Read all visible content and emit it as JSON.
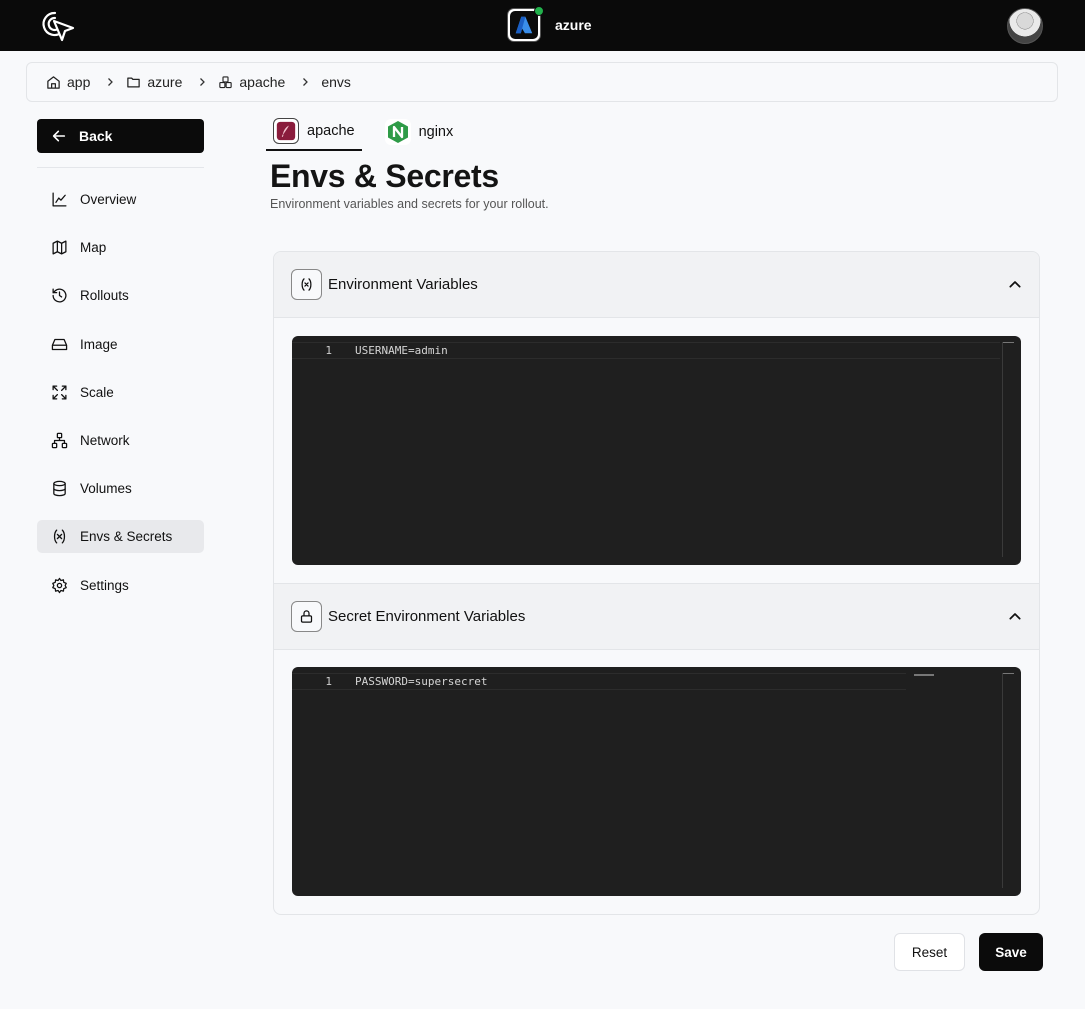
{
  "header": {
    "project_name": "azure",
    "status_color": "#22b14c"
  },
  "breadcrumb": [
    {
      "label": "app",
      "icon": "home-icon"
    },
    {
      "label": "azure",
      "icon": "folder-icon"
    },
    {
      "label": "apache",
      "icon": "boxes-icon"
    },
    {
      "label": "envs",
      "icon": ""
    }
  ],
  "sidebar": {
    "back_label": "Back",
    "items": [
      {
        "label": "Overview",
        "icon": "chart-line-icon"
      },
      {
        "label": "Map",
        "icon": "map-icon"
      },
      {
        "label": "Rollouts",
        "icon": "history-icon"
      },
      {
        "label": "Image",
        "icon": "hard-drive-icon"
      },
      {
        "label": "Scale",
        "icon": "scale-icon"
      },
      {
        "label": "Network",
        "icon": "network-icon"
      },
      {
        "label": "Volumes",
        "icon": "database-icon"
      },
      {
        "label": "Envs & Secrets",
        "icon": "variable-icon",
        "active": true
      },
      {
        "label": "Settings",
        "icon": "gear-icon"
      }
    ]
  },
  "tabs": [
    {
      "label": "apache",
      "active": true
    },
    {
      "label": "nginx",
      "active": false
    }
  ],
  "page": {
    "title": "Envs & Secrets",
    "subtitle": "Environment variables and secrets for your rollout."
  },
  "env_section": {
    "title": "Environment Variables",
    "lines": [
      {
        "num": "1",
        "code": "USERNAME=admin"
      }
    ]
  },
  "secret_section": {
    "title": "Secret Environment Variables",
    "lines": [
      {
        "num": "1",
        "code": "PASSWORD=supersecret"
      }
    ]
  },
  "actions": {
    "reset_label": "Reset",
    "save_label": "Save"
  }
}
